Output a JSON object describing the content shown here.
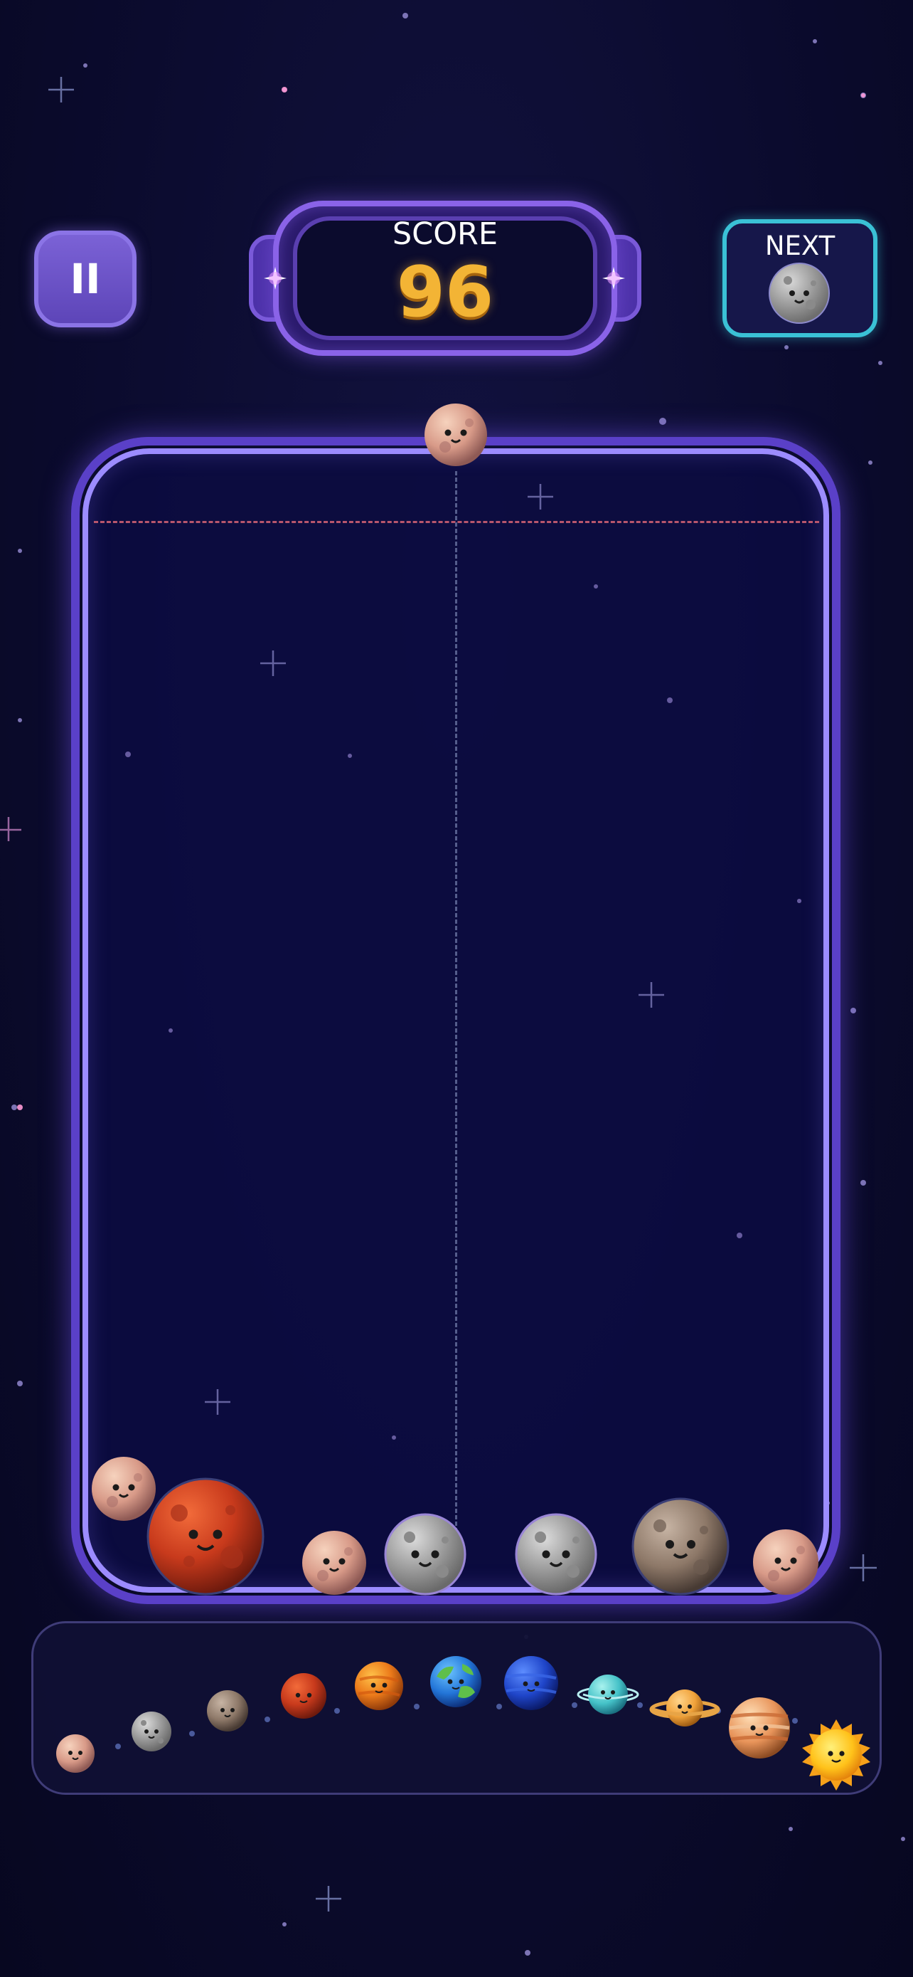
{
  "hud": {
    "pause_icon_glyph": "II",
    "score_label": "SCORE",
    "score_value": "96",
    "next_label": "NEXT",
    "next_planet": "moon"
  },
  "game": {
    "dropper_planet": "pluto",
    "danger_line_color": "#b8566c",
    "container_color": "#9c8cff",
    "stack": [
      "pluto",
      "mars-large",
      "pluto",
      "moon",
      "moon",
      "mercury",
      "pluto"
    ]
  },
  "evolution": [
    {
      "name": "pluto",
      "icon": "pluto-icon"
    },
    {
      "name": "moon",
      "icon": "moon-icon"
    },
    {
      "name": "mercury",
      "icon": "mercury-icon"
    },
    {
      "name": "mars",
      "icon": "mars-icon"
    },
    {
      "name": "venus",
      "icon": "venus-icon"
    },
    {
      "name": "earth",
      "icon": "earth-icon"
    },
    {
      "name": "neptune",
      "icon": "neptune-icon"
    },
    {
      "name": "uranus",
      "icon": "uranus-icon"
    },
    {
      "name": "saturn",
      "icon": "saturn-icon"
    },
    {
      "name": "jupiter",
      "icon": "jupiter-icon"
    },
    {
      "name": "sun",
      "icon": "sun-icon"
    }
  ],
  "colors": {
    "score_gold": "#f3b435",
    "next_border": "#3ac1d6",
    "pause_purple": "#6a52c8"
  }
}
